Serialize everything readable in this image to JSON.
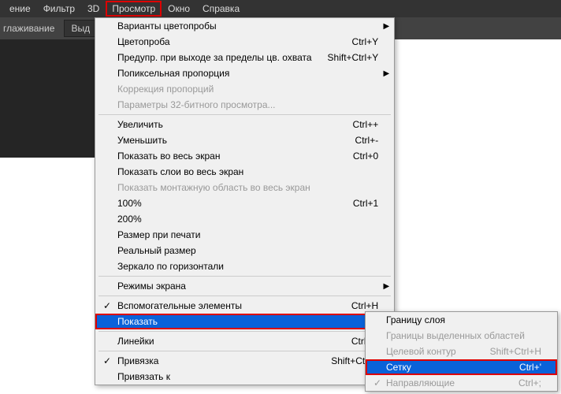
{
  "menubar": {
    "items": [
      "ение",
      "Фильтр",
      "3D",
      "Просмотр",
      "Окно",
      "Справка"
    ],
    "highlighted_index": 3
  },
  "toolbar": {
    "text1": "глаживание",
    "btn1": "Выд"
  },
  "main_menu": [
    {
      "label": "Варианты цветопробы",
      "arrow": true
    },
    {
      "label": "Цветопроба",
      "shortcut": "Ctrl+Y"
    },
    {
      "label": "Предупр. при выходе за пределы цв. охвата",
      "shortcut": "Shift+Ctrl+Y"
    },
    {
      "label": "Попиксельная пропорция",
      "arrow": true
    },
    {
      "label": "Коррекция пропорций",
      "disabled": true
    },
    {
      "label": "Параметры 32-битного просмотра...",
      "disabled": true
    },
    {
      "sep": true
    },
    {
      "label": "Увеличить",
      "shortcut": "Ctrl++"
    },
    {
      "label": "Уменьшить",
      "shortcut": "Ctrl+-"
    },
    {
      "label": "Показать во весь экран",
      "shortcut": "Ctrl+0"
    },
    {
      "label": "Показать слои во весь экран"
    },
    {
      "label": "Показать монтажную область во весь экран",
      "disabled": true
    },
    {
      "label": "100%",
      "shortcut": "Ctrl+1"
    },
    {
      "label": "200%"
    },
    {
      "label": "Размер при печати"
    },
    {
      "label": "Реальный размер"
    },
    {
      "label": "Зеркало по горизонтали"
    },
    {
      "sep": true
    },
    {
      "label": "Режимы экрана",
      "arrow": true
    },
    {
      "sep": true
    },
    {
      "label": "Вспомогательные элементы",
      "shortcut": "Ctrl+H",
      "check": true
    },
    {
      "label": "Показать",
      "arrow": true,
      "selected": true,
      "boxed": true
    },
    {
      "sep": true
    },
    {
      "label": "Линейки",
      "shortcut": "Ctrl+R"
    },
    {
      "sep": true
    },
    {
      "label": "Привязка",
      "shortcut": "Shift+Ctrl+;",
      "check": true
    },
    {
      "label": "Привязать к",
      "arrow": true
    }
  ],
  "submenu": [
    {
      "label": "Границу слоя"
    },
    {
      "label": "Границы выделенных областей",
      "disabled": true
    },
    {
      "label": "Целевой контур",
      "shortcut": "Shift+Ctrl+H",
      "disabled": true
    },
    {
      "label": "Сетку",
      "shortcut": "Ctrl+'",
      "selected": true,
      "boxed": true
    },
    {
      "label": "Направляющие",
      "shortcut": "Ctrl+;",
      "disabled": true,
      "check": true
    }
  ]
}
